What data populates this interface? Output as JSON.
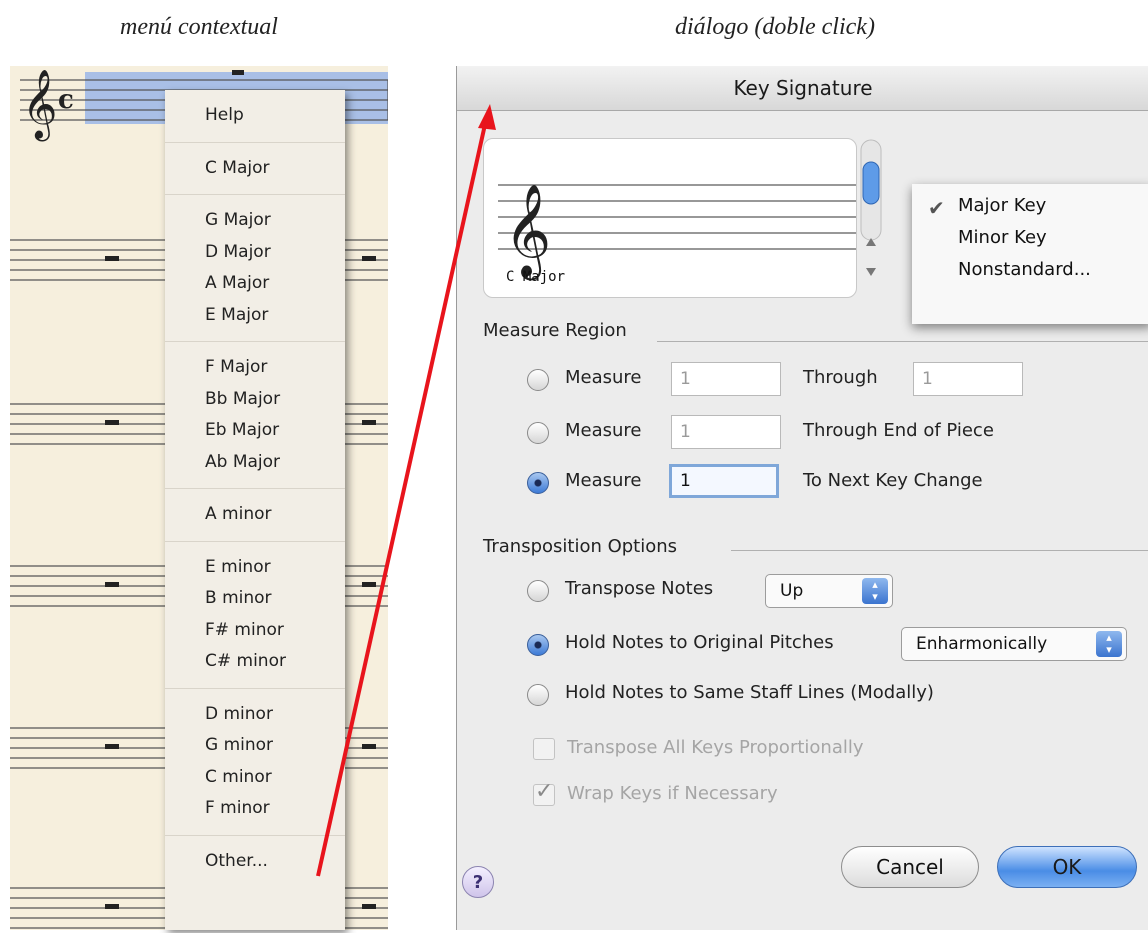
{
  "captions": {
    "left": "menú contextual",
    "right": "diálogo (doble click)"
  },
  "context_menu": {
    "groups": [
      [
        "Help"
      ],
      [
        "C Major"
      ],
      [
        "G Major",
        "D Major",
        "A Major",
        "E Major"
      ],
      [
        "F Major",
        "Bb Major",
        "Eb Major",
        "Ab Major"
      ],
      [
        "A minor"
      ],
      [
        "E minor",
        "B minor",
        "F# minor",
        "C# minor"
      ],
      [
        "D minor",
        "G minor",
        "C minor",
        "F minor"
      ],
      [
        "Other..."
      ]
    ]
  },
  "dialog": {
    "title": "Key Signature",
    "preview_caption": "C Major",
    "mode_popup": {
      "options": [
        "Major Key",
        "Minor Key",
        "Nonstandard..."
      ],
      "checked": "Major Key"
    },
    "measure_region": {
      "heading": "Measure Region",
      "rows": [
        {
          "label": "Measure",
          "value": "1",
          "option": "Through",
          "option_value": "1",
          "selected": false
        },
        {
          "label": "Measure",
          "value": "1",
          "option": "Through End of Piece",
          "selected": false
        },
        {
          "label": "Measure",
          "value": "1",
          "option": "To Next Key Change",
          "selected": true
        }
      ]
    },
    "transposition": {
      "heading": "Transposition Options",
      "transpose_notes": "Transpose Notes",
      "direction": "Up",
      "hold_original": "Hold Notes to Original Pitches",
      "hold_mode": "Enharmonically",
      "hold_staff": "Hold Notes to Same Staff Lines (Modally)",
      "transpose_all": "Transpose All Keys Proportionally",
      "wrap_keys": "Wrap Keys if Necessary"
    },
    "buttons": {
      "help": "?",
      "cancel": "Cancel",
      "ok": "OK"
    }
  },
  "colors": {
    "arrow": "#e8141c",
    "selection": "#a9bfe6",
    "paper": "#f6efdd"
  }
}
